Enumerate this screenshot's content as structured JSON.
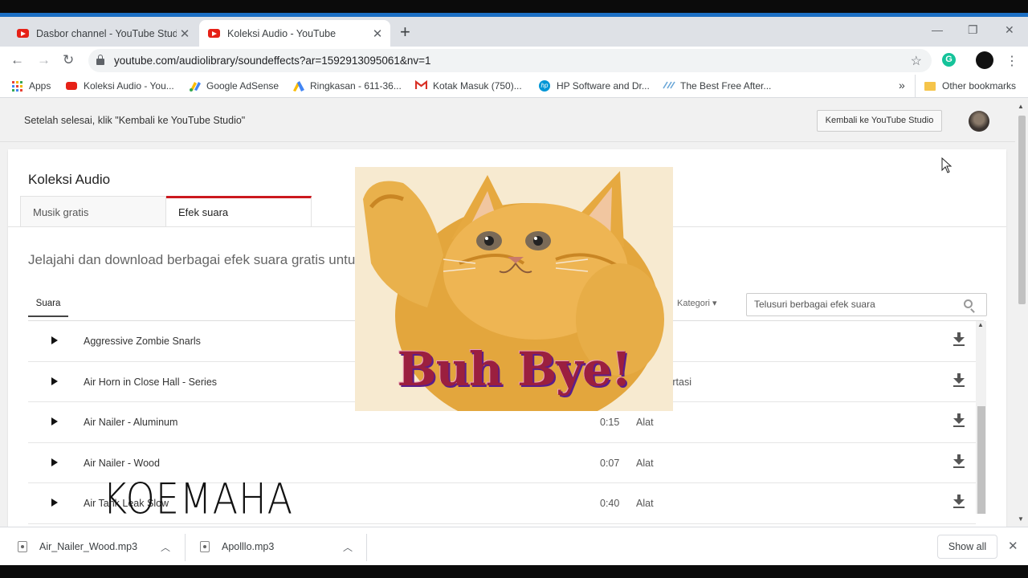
{
  "browser": {
    "tabs": [
      {
        "title": "Dasbor channel - YouTube Studio",
        "close": "✕"
      },
      {
        "title": "Koleksi Audio - YouTube",
        "close": "✕"
      }
    ],
    "new_tab": "+",
    "window_controls": {
      "minimize": "—",
      "restore": "❐",
      "close": "✕"
    },
    "url": "youtube.com/audiolibrary/soundeffects?ar=1592913095061&nv=1",
    "nav": {
      "back": "←",
      "forward": "→",
      "reload": "↻"
    },
    "star": "☆",
    "ext_label": "G",
    "menu": "⋮"
  },
  "bookmarks": {
    "items": [
      {
        "label": "Apps",
        "icon": "apps-grid-icon"
      },
      {
        "label": "Koleksi Audio - You...",
        "icon": "youtube-icon"
      },
      {
        "label": "Google AdSense",
        "icon": "adsense-icon"
      },
      {
        "label": "Ringkasan - 611-36...",
        "icon": "google-ads-icon"
      },
      {
        "label": "Kotak Masuk (750)...",
        "icon": "gmail-icon"
      },
      {
        "label": "HP Software and Dr...",
        "icon": "hp-icon"
      },
      {
        "label": "The Best Free After...",
        "icon": "after-effects-icon"
      }
    ],
    "overflow": "»",
    "other": "Other bookmarks"
  },
  "studio_bar": {
    "text": "Setelah selesai, klik \"Kembali ke YouTube Studio\"",
    "button": "Kembali ke YouTube Studio"
  },
  "library": {
    "title": "Koleksi Audio",
    "tabs": [
      "Musik gratis",
      "Efek suara"
    ],
    "description": "Jelajahi dan download berbagai efek suara gratis untuk digunakan di video Anda",
    "sub_tab": "Suara",
    "kategori": "Kategori ▾",
    "search_placeholder": "Telusuri berbagai efek suara",
    "rows": [
      {
        "name": "Aggressive Zombie Snarls",
        "duration": "",
        "category": ""
      },
      {
        "name": "Air Horn in Close Hall - Series",
        "duration": "",
        "category": "Transportasi"
      },
      {
        "name": "Air Nailer - Aluminum",
        "duration": "0:15",
        "category": "Alat"
      },
      {
        "name": "Air Nailer - Wood",
        "duration": "0:07",
        "category": "Alat"
      },
      {
        "name": "Air Tank Leak Slow",
        "duration": "0:40",
        "category": "Alat"
      }
    ]
  },
  "overlay": {
    "text": "Buh Bye!"
  },
  "watermark": "KOEMAHA",
  "downloads": {
    "items": [
      {
        "file": "Air_Nailer_Wood.mp3"
      },
      {
        "file": "Apolllo.mp3"
      }
    ],
    "show_all": "Show all",
    "close": "✕"
  },
  "colors": {
    "accent_red": "#cc181e",
    "chrome_blue": "#1c6fc4",
    "youtube_red": "#e62117"
  }
}
